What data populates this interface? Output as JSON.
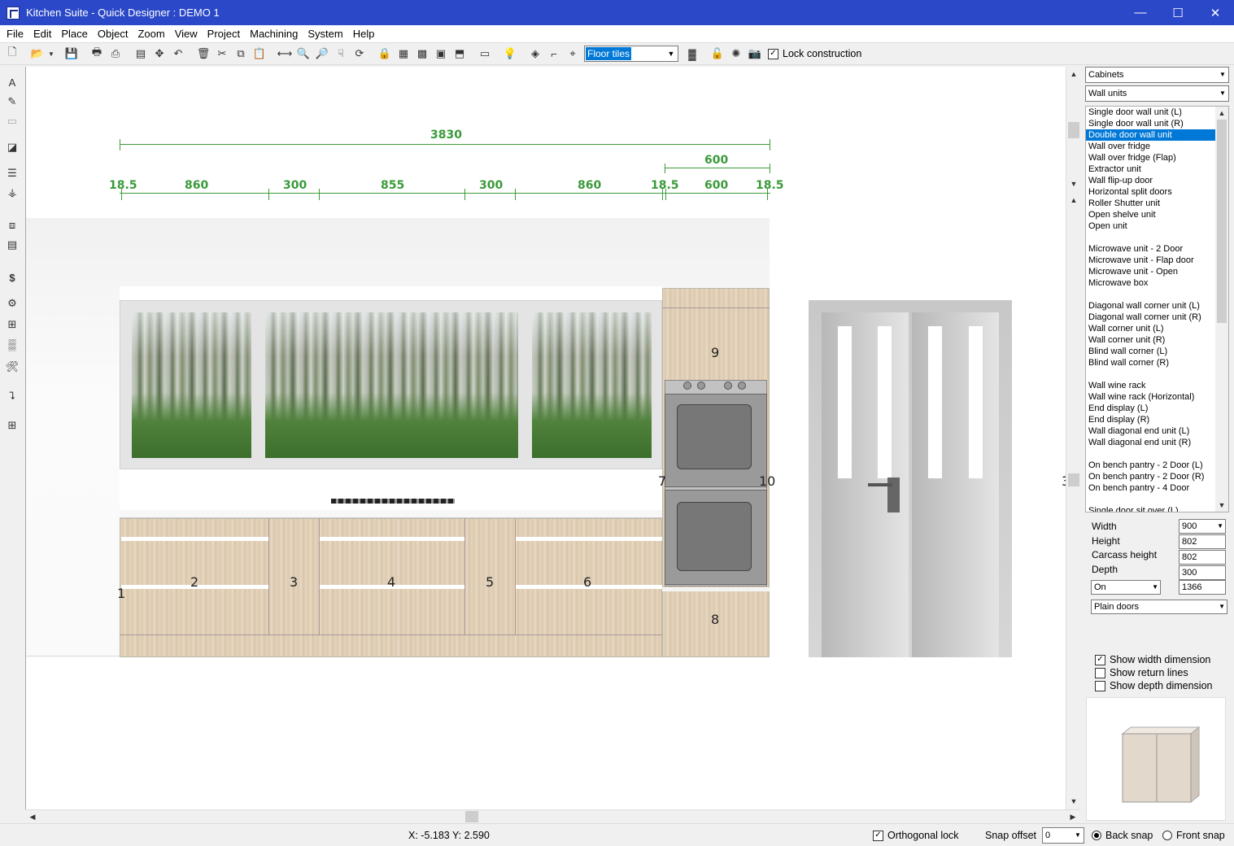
{
  "window": {
    "title": "Kitchen Suite - Quick Designer : DEMO 1",
    "minimize": "—",
    "maximize": "☐",
    "close": "✕"
  },
  "menu": [
    "File",
    "Edit",
    "Place",
    "Object",
    "Zoom",
    "View",
    "Project",
    "Machining",
    "System",
    "Help"
  ],
  "toolbar": {
    "combo_value": "Floor tiles",
    "lock_label": "Lock construction",
    "lock_checked": "✓"
  },
  "panel": {
    "category": "Cabinets",
    "subcategory": "Wall units",
    "items": [
      "Single door wall unit (L)",
      "Single door wall unit (R)",
      "Double door wall unit",
      "Wall over fridge",
      "Wall over fridge (Flap)",
      "Extractor unit",
      "Wall flip-up door",
      "Horizontal split doors",
      "Roller Shutter unit",
      "Open shelve unit",
      "Open unit",
      "",
      "Microwave unit - 2 Door",
      "Microwave unit - Flap door",
      "Microwave unit - Open",
      "Microwave box",
      "",
      "Diagonal wall corner unit (L)",
      "Diagonal wall corner unit (R)",
      "Wall corner unit (L)",
      "Wall corner unit (R)",
      "Blind wall corner (L)",
      "Blind wall corner (R)",
      "",
      "Wall wine rack",
      "Wall wine rack (Horizontal)",
      "End display (L)",
      "End display (R)",
      "Wall diagonal end unit (L)",
      "Wall diagonal end unit (R)",
      "",
      "On bench pantry - 2 Door (L)",
      "On bench pantry - 2 Door (R)",
      "On bench pantry - 4 Door",
      "",
      "Single door sit over (L)"
    ],
    "selected_index": 2,
    "props": {
      "width_label": "Width",
      "width_value": "900",
      "height_label": "Height",
      "height_value": "802",
      "carcass_label": "Carcass height",
      "carcass_value": "802",
      "depth_label": "Depth",
      "depth_value": "300",
      "on_value": "On",
      "elev_value": "1366",
      "door_style": "Plain doors"
    },
    "checks": {
      "show_width": "Show width dimension",
      "show_width_checked": "✓",
      "show_return": "Show return lines",
      "show_depth": "Show depth dimension"
    }
  },
  "drawing": {
    "total_width": "3830",
    "tall_width": "600",
    "dims": [
      "18.5",
      "860",
      "300",
      "855",
      "300",
      "860",
      "18.5",
      "600",
      "18.5"
    ],
    "numbers": [
      "1",
      "2",
      "3",
      "4",
      "5",
      "6",
      "7",
      "8",
      "9",
      "10",
      "3"
    ]
  },
  "status": {
    "coords": "X: -5.183   Y: 2.590",
    "ortho_label": "Orthogonal lock",
    "ortho_checked": "✓",
    "snap_label": "Snap offset",
    "snap_value": "0",
    "back_snap": "Back snap",
    "front_snap": "Front snap"
  }
}
